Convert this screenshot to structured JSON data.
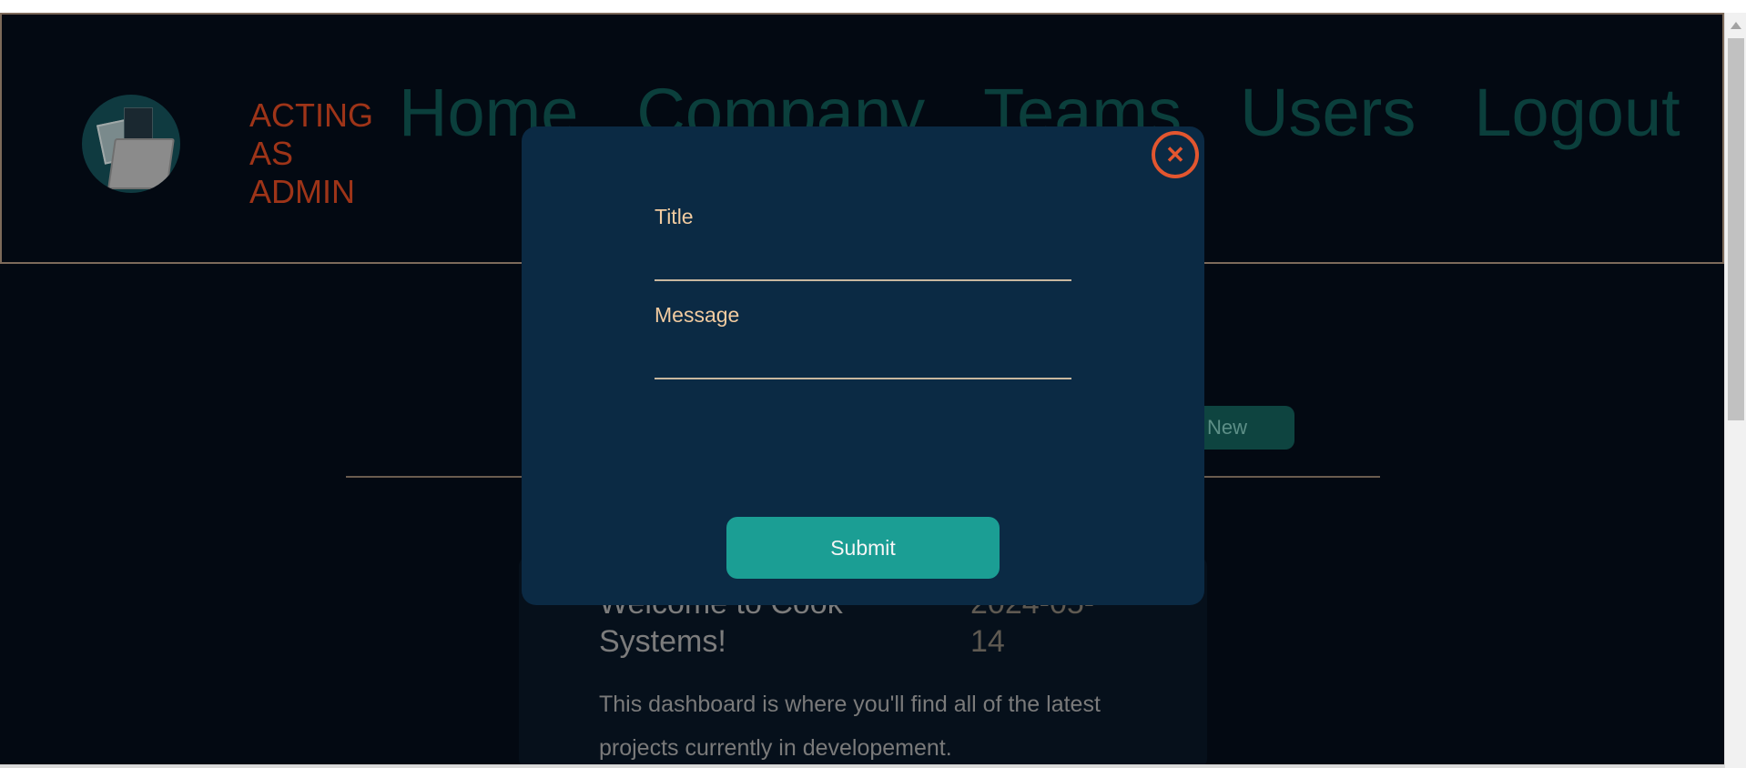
{
  "header": {
    "acting_label": "ACTING AS ADMIN",
    "nav": [
      "Home",
      "Company",
      "Teams",
      "Users",
      "Logout"
    ]
  },
  "toolbar": {
    "new_label": "New"
  },
  "announcement": {
    "title": "Welcome to Cook Systems!",
    "date": "2024-05-14",
    "text": "This dashboard is where you'll find all of the latest projects currently in developement."
  },
  "modal": {
    "title_label": "Title",
    "title_value": "",
    "message_label": "Message",
    "message_value": "",
    "submit_label": "Submit",
    "close_icon": "close-icon"
  },
  "colors": {
    "background": "#030912",
    "modal": "#0b2a44",
    "accent": "#1b9e94",
    "close": "#e3562f",
    "acting": "#9e3418"
  }
}
